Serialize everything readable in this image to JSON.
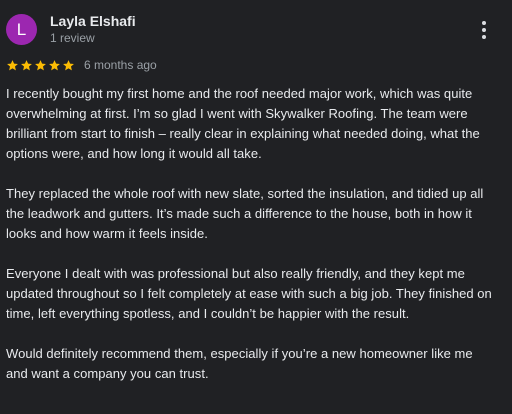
{
  "reviewer": {
    "initial": "L",
    "name": "Layla Elshafi",
    "review_count": "1 review",
    "avatar_color": "#9c27b0"
  },
  "rating": {
    "stars": 5,
    "max": 5,
    "star_color": "#fbbc04",
    "date": "6 months ago"
  },
  "menu_icon": "more-vert-icon",
  "paragraphs": [
    "I recently bought my first home and the roof needed major work, which was quite overwhelming at first. I’m so glad I went with Skywalker Roofing. The team were brilliant from start to finish – really clear in explaining what needed doing, what the options were, and how long it would all take.",
    "They replaced the whole roof with new slate, sorted the insulation, and tidied up all the leadwork and gutters. It’s made such a difference to the house, both in how it looks and how warm it feels inside.",
    "Everyone I dealt with was professional but also really friendly, and they kept me updated throughout so I felt completely at ease with such a big job. They finished on time, left everything spotless, and I couldn’t be happier with the result.",
    "Would definitely recommend them, especially if you’re a new homeowner like me and want a company you can trust."
  ]
}
